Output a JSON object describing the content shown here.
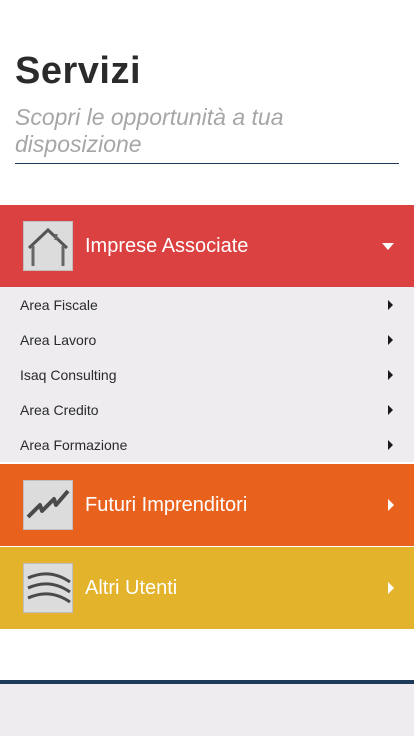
{
  "header": {
    "title": "Servizi",
    "subtitle": "Scopri le opportunità a tua disposizione"
  },
  "sections": [
    {
      "label": "Imprese Associate",
      "icon": "house-icon",
      "color": "#dc4141",
      "expanded": true,
      "items": [
        {
          "label": "Area Fiscale"
        },
        {
          "label": "Area Lavoro"
        },
        {
          "label": "Isaq Consulting"
        },
        {
          "label": "Area Credito"
        },
        {
          "label": "Area Formazione"
        }
      ]
    },
    {
      "label": "Futuri Imprenditori",
      "icon": "lightning-icon",
      "color": "#e8621e",
      "expanded": false
    },
    {
      "label": "Altri Utenti",
      "icon": "wave-icon",
      "color": "#e3b32b",
      "expanded": false
    }
  ]
}
